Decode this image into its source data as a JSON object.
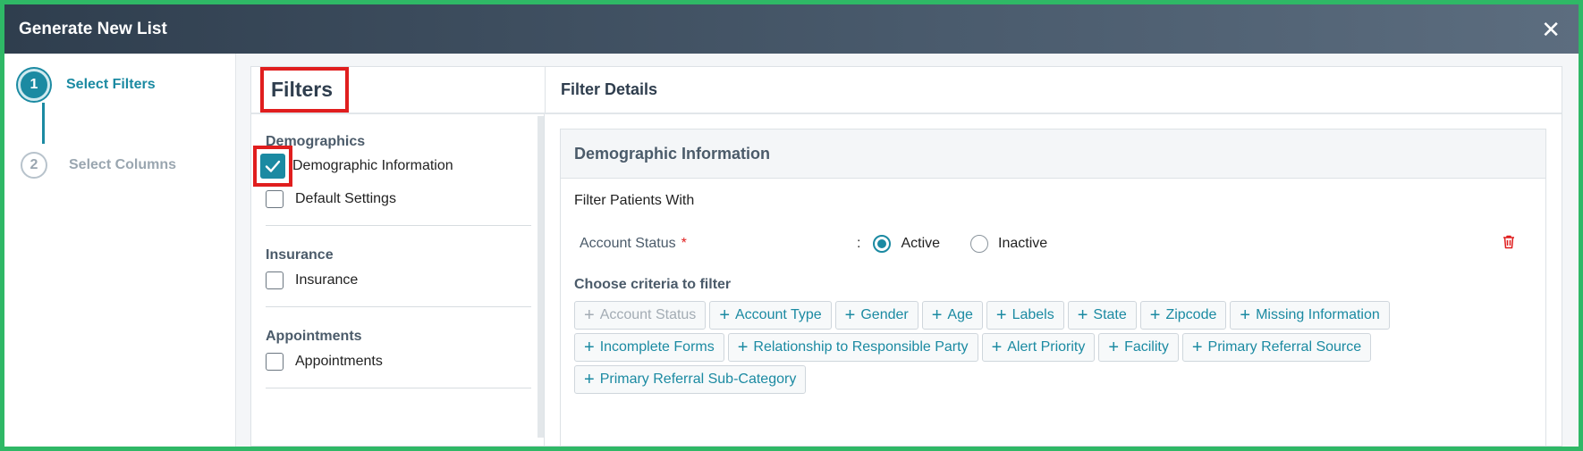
{
  "header": {
    "title": "Generate New List"
  },
  "stepper": {
    "steps": [
      {
        "number": "1",
        "label": "Select Filters"
      },
      {
        "number": "2",
        "label": "Select Columns"
      }
    ]
  },
  "filters": {
    "title": "Filters",
    "groups": [
      {
        "title": "Demographics",
        "items": [
          {
            "label": "Demographic Information",
            "checked": true
          },
          {
            "label": "Default Settings",
            "checked": false
          }
        ]
      },
      {
        "title": "Insurance",
        "items": [
          {
            "label": "Insurance",
            "checked": false
          }
        ]
      },
      {
        "title": "Appointments",
        "items": [
          {
            "label": "Appointments",
            "checked": false
          }
        ]
      }
    ]
  },
  "details": {
    "title": "Filter Details",
    "card_title": "Demographic Information",
    "filter_patients_with": "Filter Patients With",
    "account_status": {
      "label": "Account Status",
      "required_mark": "*",
      "colon": ":",
      "options": [
        {
          "label": "Active",
          "selected": true
        },
        {
          "label": "Inactive",
          "selected": false
        }
      ]
    },
    "criteria_title": "Choose criteria to filter",
    "criteria": [
      "Account Status",
      "Account Type",
      "Gender",
      "Age",
      "Labels",
      "State",
      "Zipcode",
      "Missing Information",
      "Incomplete Forms",
      "Relationship to Responsible Party",
      "Alert Priority",
      "Facility",
      "Primary Referral Source",
      "Primary Referral Sub-Category"
    ],
    "criteria_disabled": [
      "Account Status"
    ]
  },
  "colors": {
    "accent": "#1b8aa2",
    "highlight": "#e01e1e",
    "danger": "#e01e1e"
  }
}
